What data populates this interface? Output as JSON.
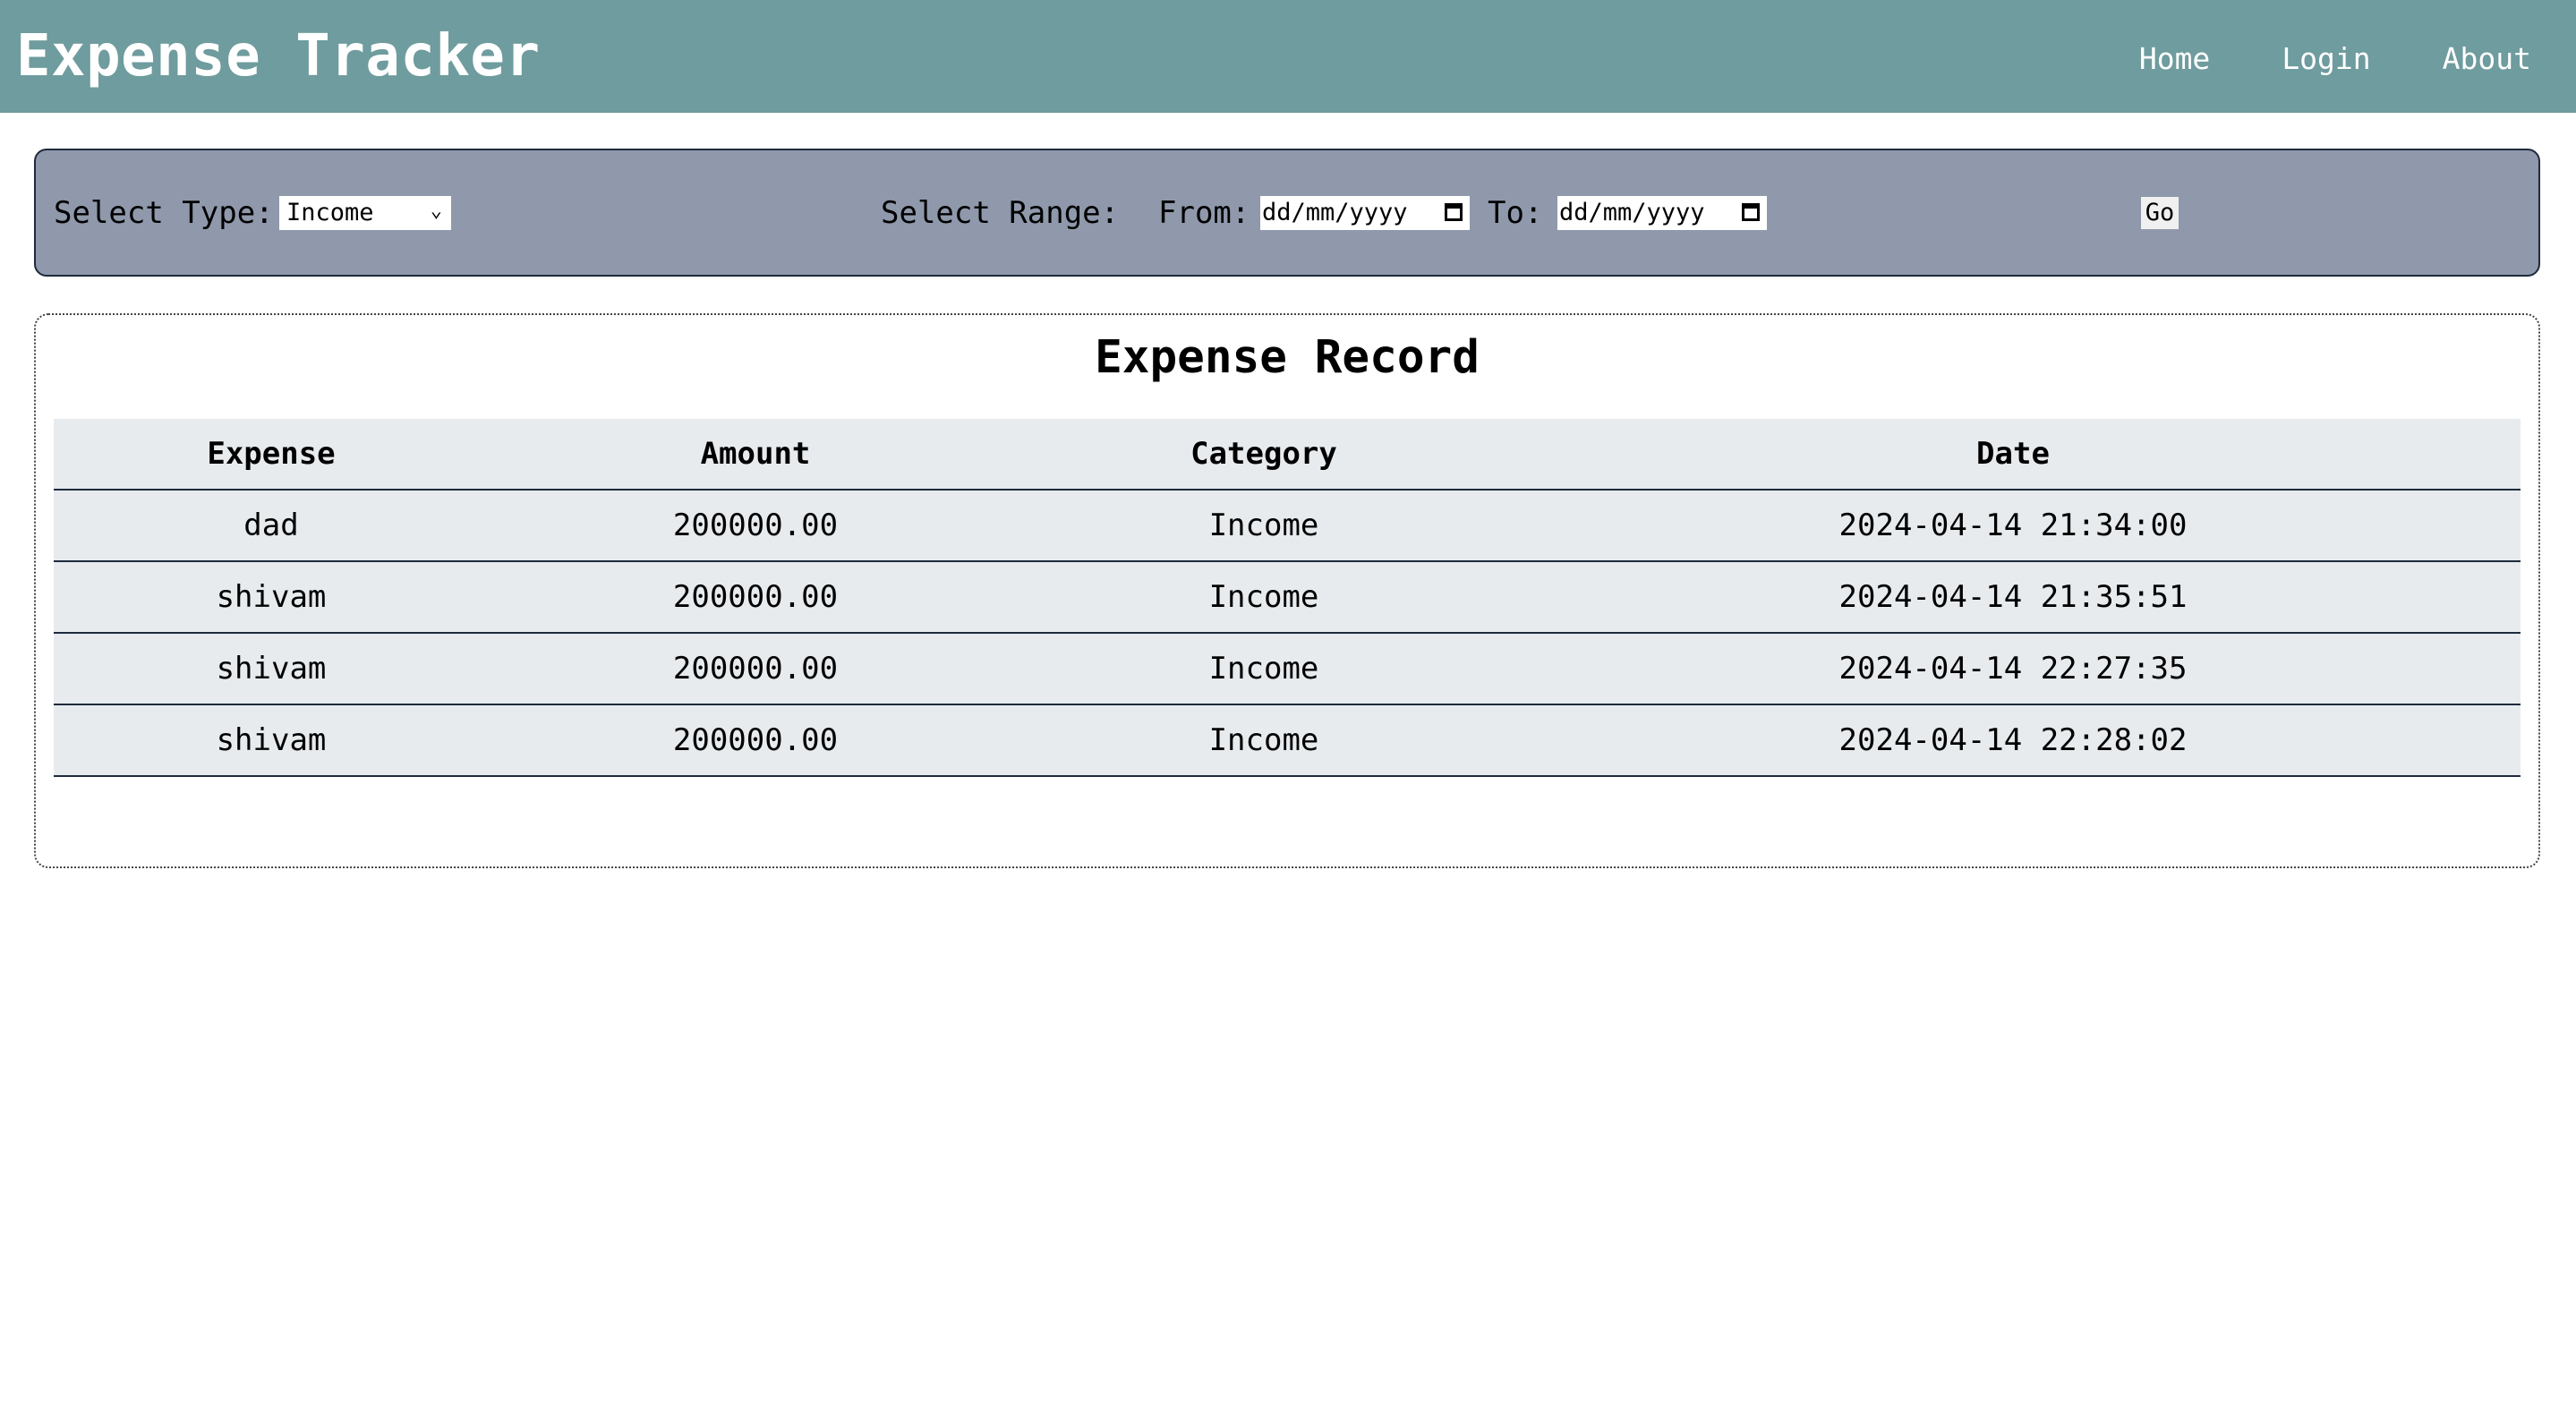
{
  "header": {
    "title": "Expense Tracker",
    "nav": [
      "Home",
      "Login",
      "About"
    ]
  },
  "filter": {
    "type_label": "Select Type:",
    "type_value": "Income",
    "range_label": "Select Range:",
    "from_label": "From:",
    "from_placeholder": "dd/mm/yyyy",
    "to_label": "To:",
    "to_placeholder": "dd/mm/yyyy",
    "go_label": "Go"
  },
  "record": {
    "title": "Expense Record",
    "columns": [
      "Expense",
      "Amount",
      "Category",
      "Date"
    ],
    "rows": [
      [
        "dad",
        "200000.00",
        "Income",
        "2024-04-14 21:34:00"
      ],
      [
        "shivam",
        "200000.00",
        "Income",
        "2024-04-14 21:35:51"
      ],
      [
        "shivam",
        "200000.00",
        "Income",
        "2024-04-14 22:27:35"
      ],
      [
        "shivam",
        "200000.00",
        "Income",
        "2024-04-14 22:28:02"
      ]
    ]
  },
  "colors": {
    "header_bg": "#6f9c9e",
    "filter_bg": "#8f99ab",
    "table_bg": "#e7ebee"
  }
}
